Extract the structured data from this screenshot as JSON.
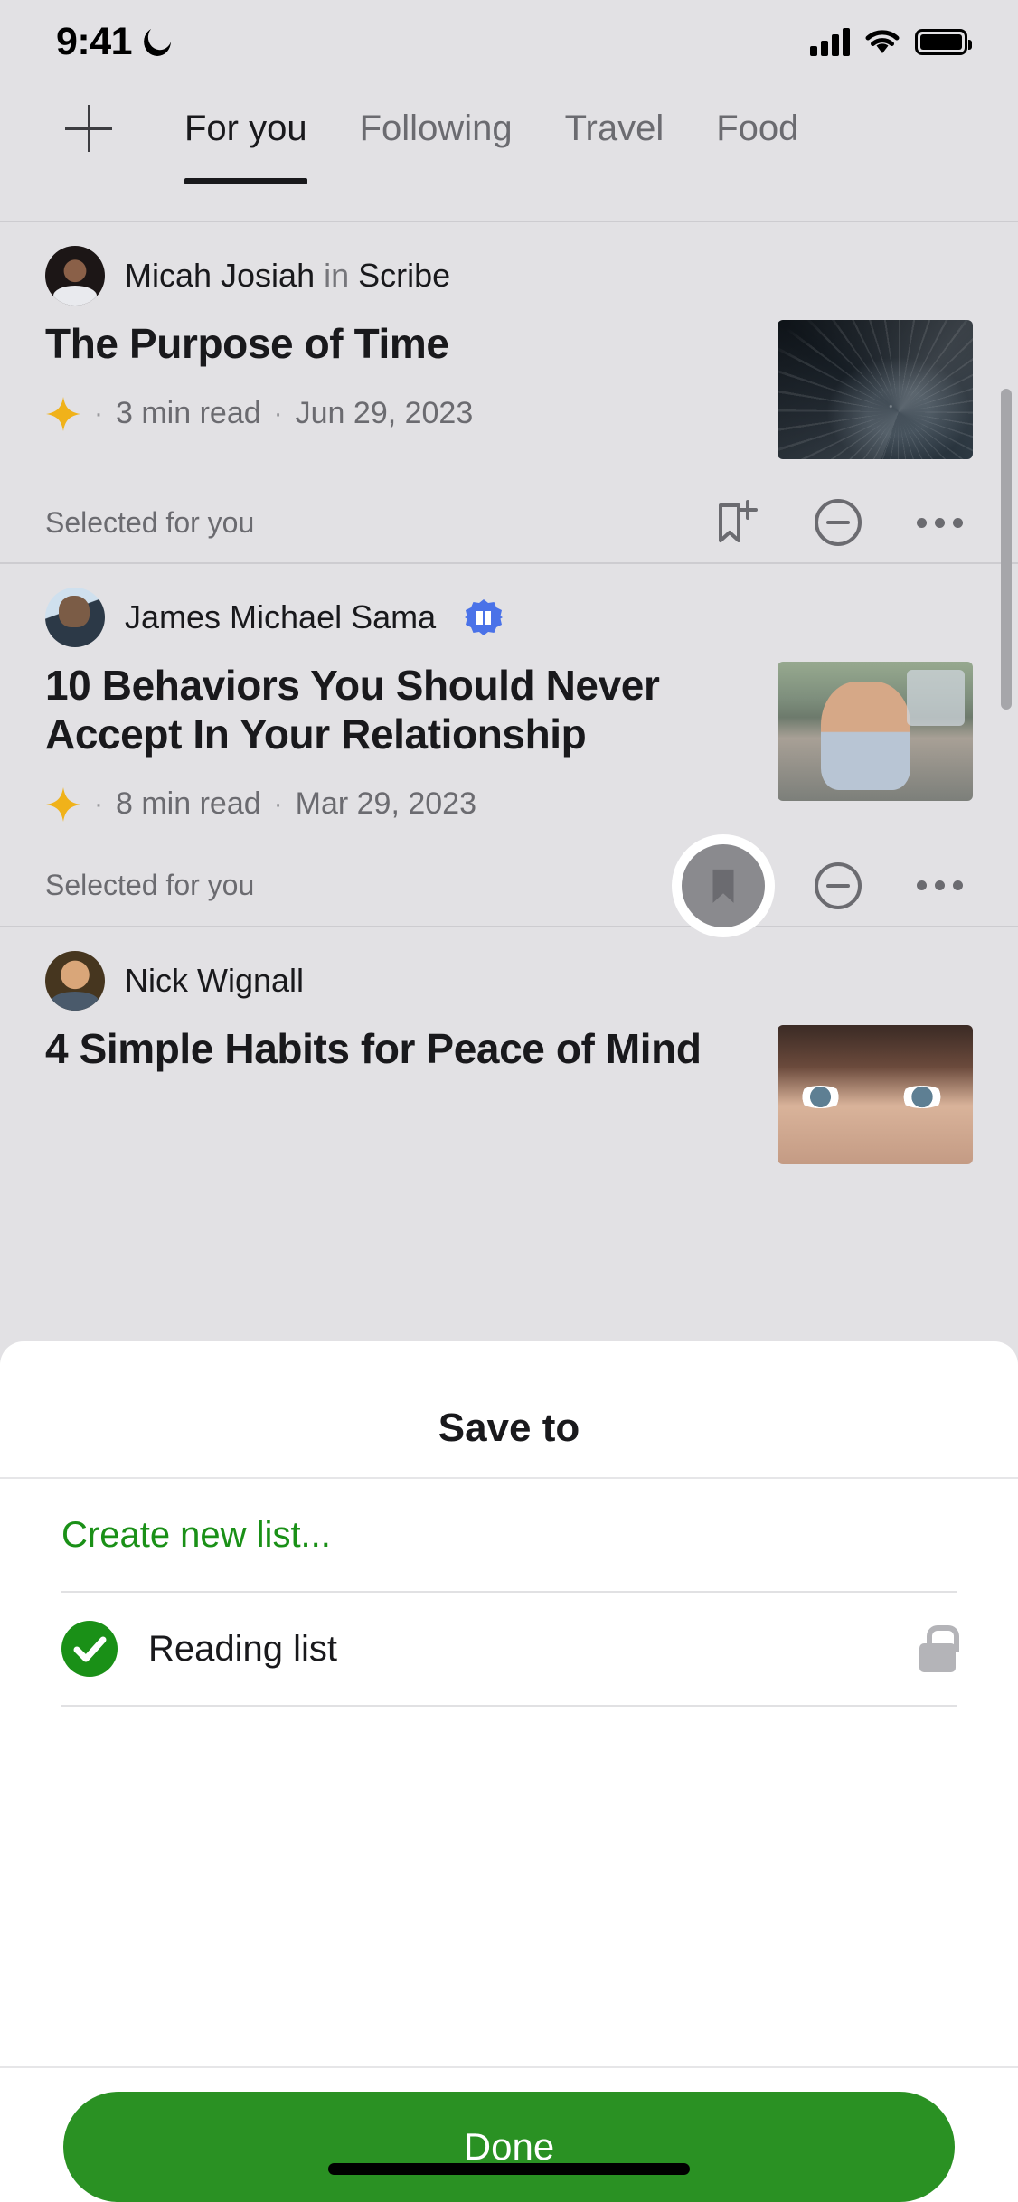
{
  "status_bar": {
    "time": "9:41",
    "icons": [
      "moon-icon",
      "cellular-signal-icon",
      "wifi-icon",
      "battery-icon"
    ]
  },
  "tabs": {
    "add_label": "+",
    "items": [
      {
        "label": "For you",
        "active": true
      },
      {
        "label": "Following",
        "active": false
      },
      {
        "label": "Travel",
        "active": false
      },
      {
        "label": "Food",
        "active": false
      }
    ]
  },
  "feed": {
    "articles": [
      {
        "author": "Micah Josiah",
        "in_word": "in",
        "publication": "Scribe",
        "verified": false,
        "title": "The Purpose of Time",
        "member_only": true,
        "read_time": "3  min read",
        "date": "Jun 29, 2023",
        "footer_label": "Selected for you",
        "saved": false,
        "separator": "·"
      },
      {
        "author": "James Michael Sama",
        "in_word": "",
        "publication": "",
        "verified": true,
        "title": "10 Behaviors You Should Never Accept In Your Relationship",
        "member_only": true,
        "read_time": "8  min read",
        "date": "Mar 29, 2023",
        "footer_label": "Selected for you",
        "saved": true,
        "separator": "·"
      },
      {
        "author": "Nick Wignall",
        "in_word": "",
        "publication": "",
        "verified": false,
        "title": "4 Simple Habits for Peace of Mind",
        "member_only": false,
        "read_time": "",
        "date": "",
        "footer_label": "",
        "saved": false,
        "separator": "·"
      }
    ]
  },
  "save_sheet": {
    "title": "Save to",
    "create_new_label": "Create new list...",
    "lists": [
      {
        "name": "Reading list",
        "checked": true,
        "private": true
      }
    ],
    "done_label": "Done"
  },
  "colors": {
    "brand_green": "#1a9017",
    "done_green": "#2a9123",
    "member_star": "#f0b21a",
    "verified_badge": "#4a72e8",
    "page_bg": "#e2e1e4",
    "sheet_bg": "#ffffff",
    "text_primary": "#19191c",
    "text_secondary": "#6b6b70"
  }
}
